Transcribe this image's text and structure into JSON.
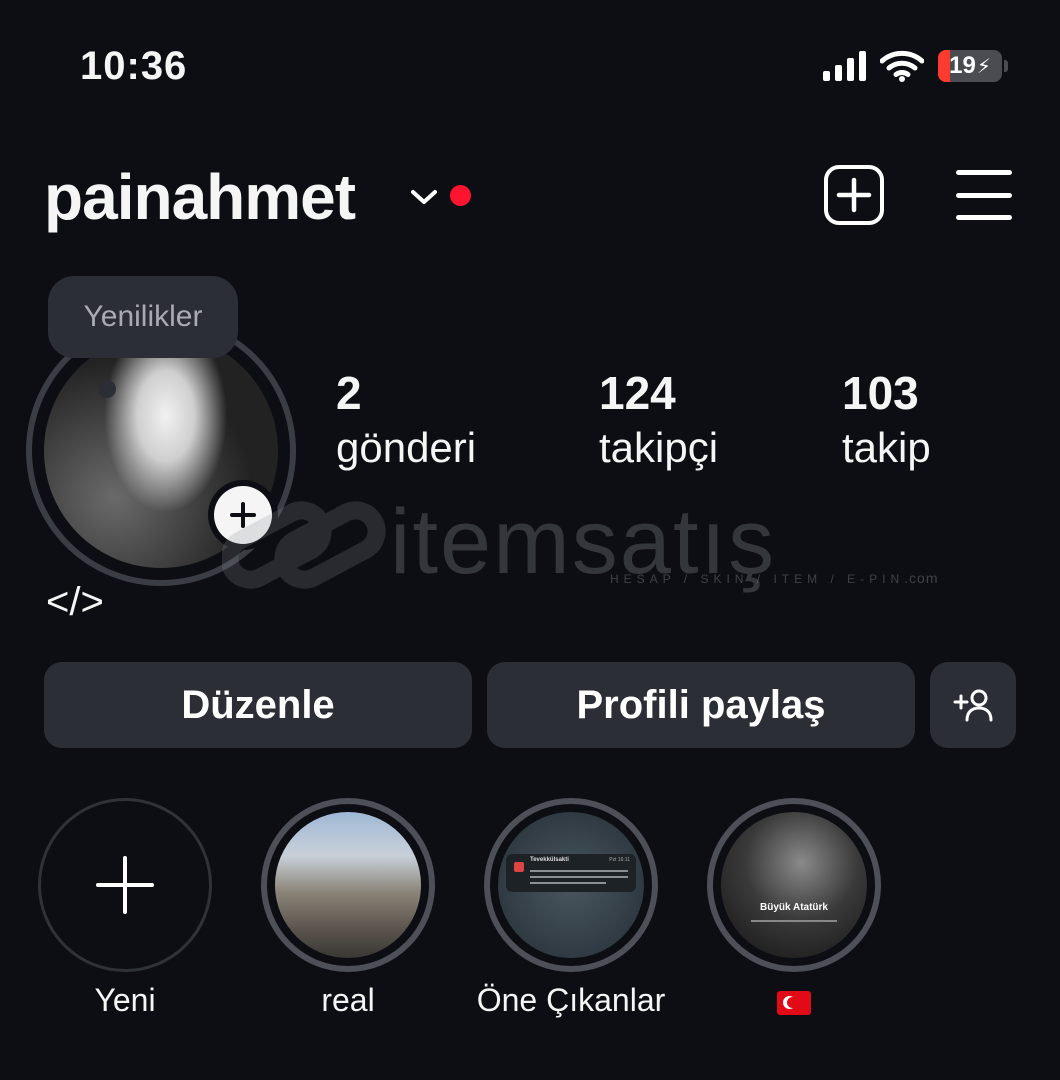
{
  "status_bar": {
    "time": "10:36",
    "battery": "19",
    "battery_fraction": 0.19,
    "battery_color": "#ff3b30"
  },
  "header": {
    "username": "painahmet",
    "notification_dot_color": "#ff1430"
  },
  "profile": {
    "tooltip": "Yenilikler",
    "bio": "</>"
  },
  "stats": [
    {
      "value": "2",
      "label": "gönderi"
    },
    {
      "value": "124",
      "label": "takipçi"
    },
    {
      "value": "103",
      "label": "takip"
    }
  ],
  "watermark": {
    "text": "itemsatış",
    "sub": "HESAP / SKIN / ITEM / E-PIN",
    "suffix": ".com"
  },
  "buttons": {
    "edit": "Düzenle",
    "share": "Profili paylaş"
  },
  "highlights": [
    {
      "label": "Yeni"
    },
    {
      "label": "real"
    },
    {
      "label": "Öne Çıkanlar"
    },
    {
      "label": "🇹🇷"
    }
  ],
  "highlight_images": {
    "notif_title": "Tevekkülsakti",
    "notif_time": "Pzt 16:11",
    "ataturk_caption": "Büyük Atatürk"
  }
}
